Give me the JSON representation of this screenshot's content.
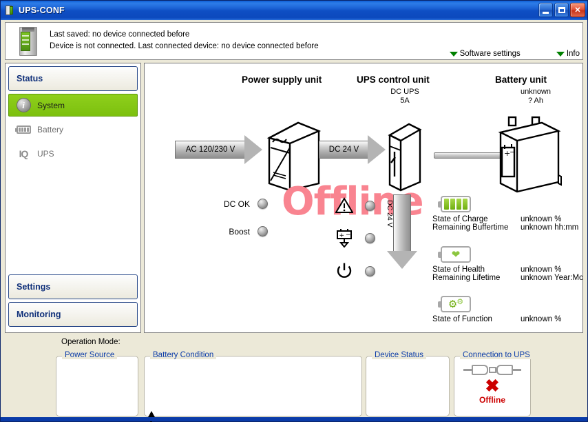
{
  "window": {
    "title": "UPS-CONF",
    "icon": "app-device-icon",
    "minimize_label": "_",
    "maximize_label": "□",
    "close_label": "✕"
  },
  "header": {
    "device_photo": "din-rail-device-photo",
    "line1": "Last saved: no device connected before",
    "line2": "Device is not connected. Last connected device: no device connected before",
    "links": [
      {
        "label": "Software settings",
        "icon": "triangle-down-icon"
      },
      {
        "label": "Info",
        "icon": "triangle-down-icon"
      }
    ]
  },
  "sidebar": {
    "status_header": "Status",
    "items": [
      {
        "label": "System",
        "icon": "info-circle-icon",
        "active": true
      },
      {
        "label": "Battery",
        "icon": "battery-icon",
        "active": false
      },
      {
        "label": "UPS",
        "icon": "iq-logo-icon",
        "active": false
      }
    ],
    "buttons": [
      {
        "label": "Settings"
      },
      {
        "label": "Monitoring"
      }
    ]
  },
  "diagram": {
    "watermark": "Offline",
    "power_supply": {
      "title": "Power supply unit",
      "input_arrow": "AC 120/230 V",
      "output_arrow": "DC 24 V",
      "leds": [
        {
          "label": "DC OK",
          "state": "off"
        },
        {
          "label": "Boost",
          "state": "off"
        }
      ]
    },
    "ups_control": {
      "title": "UPS control unit",
      "subtitle_line1": "DC UPS",
      "subtitle_line2": "5A",
      "output_arrow": "DC 24 V",
      "indicators": [
        {
          "icon": "warning-triangle-icon",
          "state": "off"
        },
        {
          "icon": "battery-discharge-icon",
          "state": "off"
        },
        {
          "icon": "power-icon",
          "state": "off"
        }
      ]
    },
    "battery_unit": {
      "title": "Battery unit",
      "subtitle_line1": "unknown",
      "subtitle_line2": "? Ah",
      "groups": [
        {
          "icon": "battery-charge-icon",
          "rows": [
            {
              "key": "State of Charge",
              "value": "unknown %"
            },
            {
              "key": "Remaining Buffertime",
              "value": "unknown hh:mm"
            }
          ]
        },
        {
          "icon": "battery-health-heart-icon",
          "rows": [
            {
              "key": "State of Health",
              "value": "unknown %"
            },
            {
              "key": "Remaining Lifetime",
              "value": "unknown Year:Month"
            }
          ]
        },
        {
          "icon": "battery-function-gears-icon",
          "rows": [
            {
              "key": "State of Function",
              "value": "unknown %"
            }
          ]
        }
      ]
    }
  },
  "operation_mode": {
    "label": "Operation Mode:",
    "value": ""
  },
  "bottom_panels": [
    {
      "legend": "Power Source",
      "value": ""
    },
    {
      "legend": "Battery Condition",
      "value": ""
    },
    {
      "legend": "Device Status",
      "value": ""
    }
  ],
  "connection_panel": {
    "legend": "Connection to UPS",
    "icon": "usb-disconnected-icon",
    "x_mark": "✖",
    "status": "Offline"
  },
  "colors": {
    "accent_green": "#7cc00e",
    "title_blue": "#0a3ba8",
    "offline_red": "#cc0000",
    "watermark_pink": "#f98490"
  }
}
